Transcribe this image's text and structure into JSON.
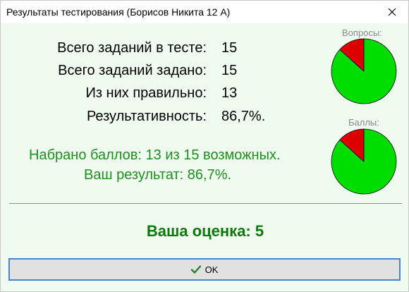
{
  "window": {
    "title": "Результаты тестирования (Борисов Никита 12 А)"
  },
  "stats": [
    {
      "label": "Всего заданий в тесте:",
      "value": "15"
    },
    {
      "label": "Всего заданий задано:",
      "value": "15"
    },
    {
      "label": "Из них правильно:",
      "value": "13"
    },
    {
      "label": "Результативность:",
      "value": "86,7%."
    }
  ],
  "charts": {
    "questions_label": "Вопросы:",
    "points_label": "Баллы:",
    "correct_color": "#00dd00",
    "wrong_color": "#dd0000"
  },
  "chart_data": [
    {
      "type": "pie",
      "title": "Вопросы:",
      "categories": [
        "correct",
        "incorrect"
      ],
      "values": [
        13,
        2
      ]
    },
    {
      "type": "pie",
      "title": "Баллы:",
      "categories": [
        "correct",
        "incorrect"
      ],
      "values": [
        13,
        2
      ]
    }
  ],
  "summary": {
    "points": "Набрано баллов: 13 из 15 возможных.",
    "result": "Ваш результат: 86,7%."
  },
  "grade": "Ваша оценка: 5",
  "ok_button": {
    "label": "OK",
    "icon": "checkmark-icon"
  },
  "close_icon": "close-icon"
}
